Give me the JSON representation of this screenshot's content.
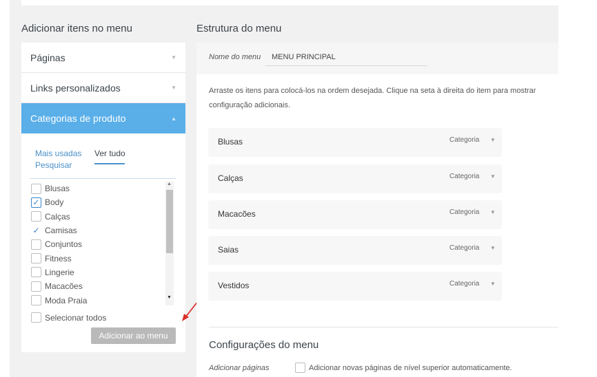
{
  "left": {
    "title": "Adicionar itens no menu",
    "sections": [
      {
        "label": "Páginas"
      },
      {
        "label": "Links personalizados"
      },
      {
        "label": "Categorias de produto"
      }
    ],
    "tabs": {
      "most_used": "Mais usadas",
      "view_all": "Ver tudo",
      "search": "Pesquisar"
    },
    "categories": [
      {
        "label": "Blusas",
        "checked": false
      },
      {
        "label": "Body",
        "checked": true
      },
      {
        "label": "Calças",
        "checked": false
      },
      {
        "label": "Camisas",
        "checked": true
      },
      {
        "label": "Conjuntos",
        "checked": false
      },
      {
        "label": "Fitness",
        "checked": false
      },
      {
        "label": "Lingerie",
        "checked": false
      },
      {
        "label": "Macacões",
        "checked": false
      },
      {
        "label": "Moda Praia",
        "checked": false
      }
    ],
    "select_all": "Selecionar todos",
    "add_button": "Adicionar ao menu"
  },
  "right": {
    "title": "Estrutura do menu",
    "name_label": "Nome do menu",
    "name_value": "MENU PRINCIPAL",
    "instructions_line1": "Arraste os itens para colocá-los na ordem desejada. Clique na seta à direita do item para mostrar",
    "instructions_line2": "configuração adicionais.",
    "menu_items": [
      {
        "label": "Blusas",
        "type": "Categoria"
      },
      {
        "label": "Calças",
        "type": "Categoria"
      },
      {
        "label": "Macacões",
        "type": "Categoria"
      },
      {
        "label": "Saias",
        "type": "Categoria"
      },
      {
        "label": "Vestidos",
        "type": "Categoria"
      }
    ],
    "config_title": "Configurações do menu",
    "config_label": "Adicionar páginas",
    "config_option": "Adicionar novas páginas de nível superior automaticamente."
  },
  "colors": {
    "accent": "#5aafe9",
    "link": "#4a90c9",
    "arrow": "#d9302c"
  }
}
